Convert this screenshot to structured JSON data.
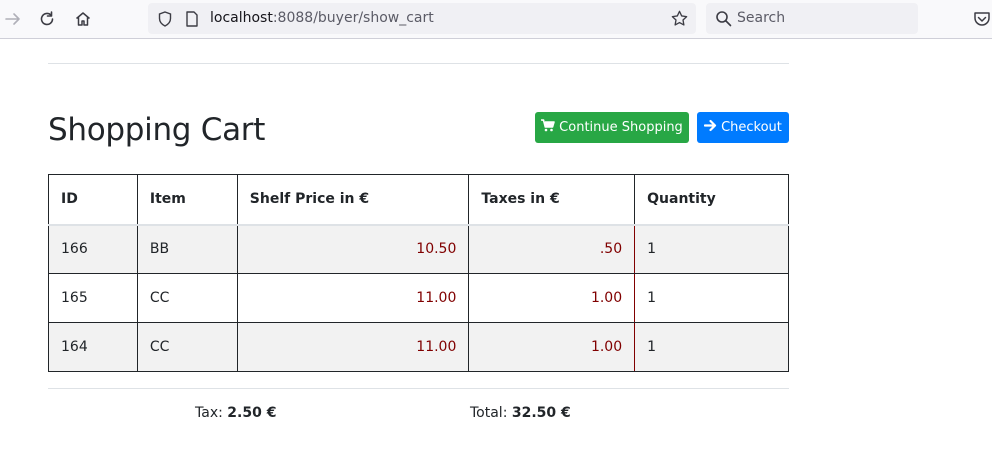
{
  "browser": {
    "url_host": "localhost",
    "url_rest": ":8088/buyer/show_cart",
    "search_placeholder": "Search"
  },
  "page": {
    "title": "Shopping Cart",
    "continue_label": "Continue Shopping",
    "checkout_label": "Checkout"
  },
  "table": {
    "headers": [
      "ID",
      "Item",
      "Shelf Price in €",
      "Taxes in €",
      "Quantity"
    ],
    "rows": [
      {
        "id": "166",
        "item": "BB",
        "price": "10.50",
        "tax": ".50",
        "qty": "1"
      },
      {
        "id": "165",
        "item": "CC",
        "price": "11.00",
        "tax": "1.00",
        "qty": "1"
      },
      {
        "id": "164",
        "item": "CC",
        "price": "11.00",
        "tax": "1.00",
        "qty": "1"
      }
    ]
  },
  "summary": {
    "tax_label": "Tax:",
    "tax_value": "2.50 €",
    "total_label": "Total:",
    "total_value": "32.50 €"
  },
  "colors": {
    "success": "#28a745",
    "primary": "#007bff",
    "price_text": "#800000"
  }
}
